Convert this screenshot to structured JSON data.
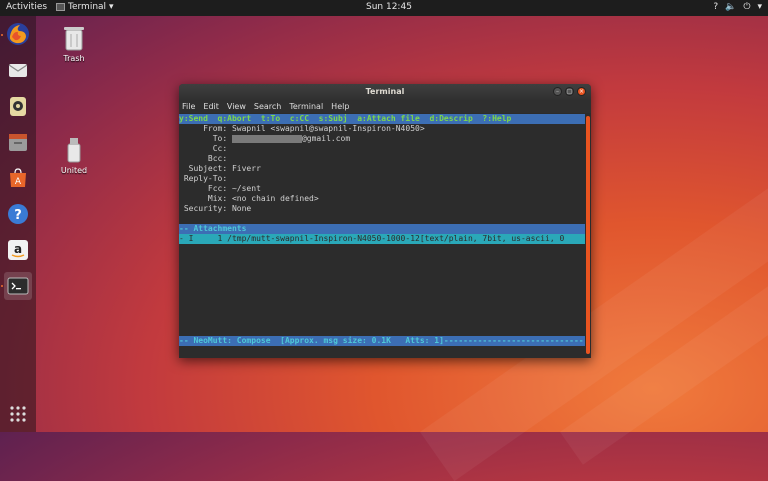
{
  "topbar": {
    "activities": "Activities",
    "app_name": "Terminal",
    "app_arrow": "▾",
    "clock": "Sun 12:45",
    "sys_icons": [
      "?",
      "🔈",
      "⏻",
      "▾"
    ]
  },
  "desktop": {
    "trash_label": "Trash",
    "united_label": "United"
  },
  "dock": {
    "items": [
      "firefox-icon",
      "mail-icon",
      "rhythmbox-icon",
      "files-icon",
      "software-icon",
      "help-icon",
      "amazon-icon",
      "terminal-icon"
    ],
    "apps_grid": "show-applications-icon"
  },
  "window": {
    "title": "Terminal",
    "menu": [
      "File",
      "Edit",
      "View",
      "Search",
      "Terminal",
      "Help"
    ],
    "accent": "#e95420"
  },
  "mutt": {
    "help_line": "y:Send  q:Abort  t:To  c:CC  s:Subj  a:Attach file  d:Descrip  ?:Help",
    "from": "     From: Swapnil <swapnil@swapnil-Inspiron-N4050>",
    "to_label": "       To: ",
    "to_domain": "@gmail.com",
    "cc": "       Cc:",
    "bcc": "      Bcc:",
    "subject": "  Subject: Fiverr",
    "replyto": " Reply-To:",
    "fcc": "      Fcc: ~/sent",
    "mix": "      Mix: <no chain defined>",
    "security": " Security: None",
    "attachments_header": "-- Attachments",
    "attachment_row": "- I     1 /tmp/mutt-swapnil-Inspiron-N4050-1000-12[text/plain, 7bit, us-ascii, 0",
    "status_line": "-- NeoMutt: Compose  [Approx. msg size: 0.1K   Atts: 1]-----------------------------"
  }
}
